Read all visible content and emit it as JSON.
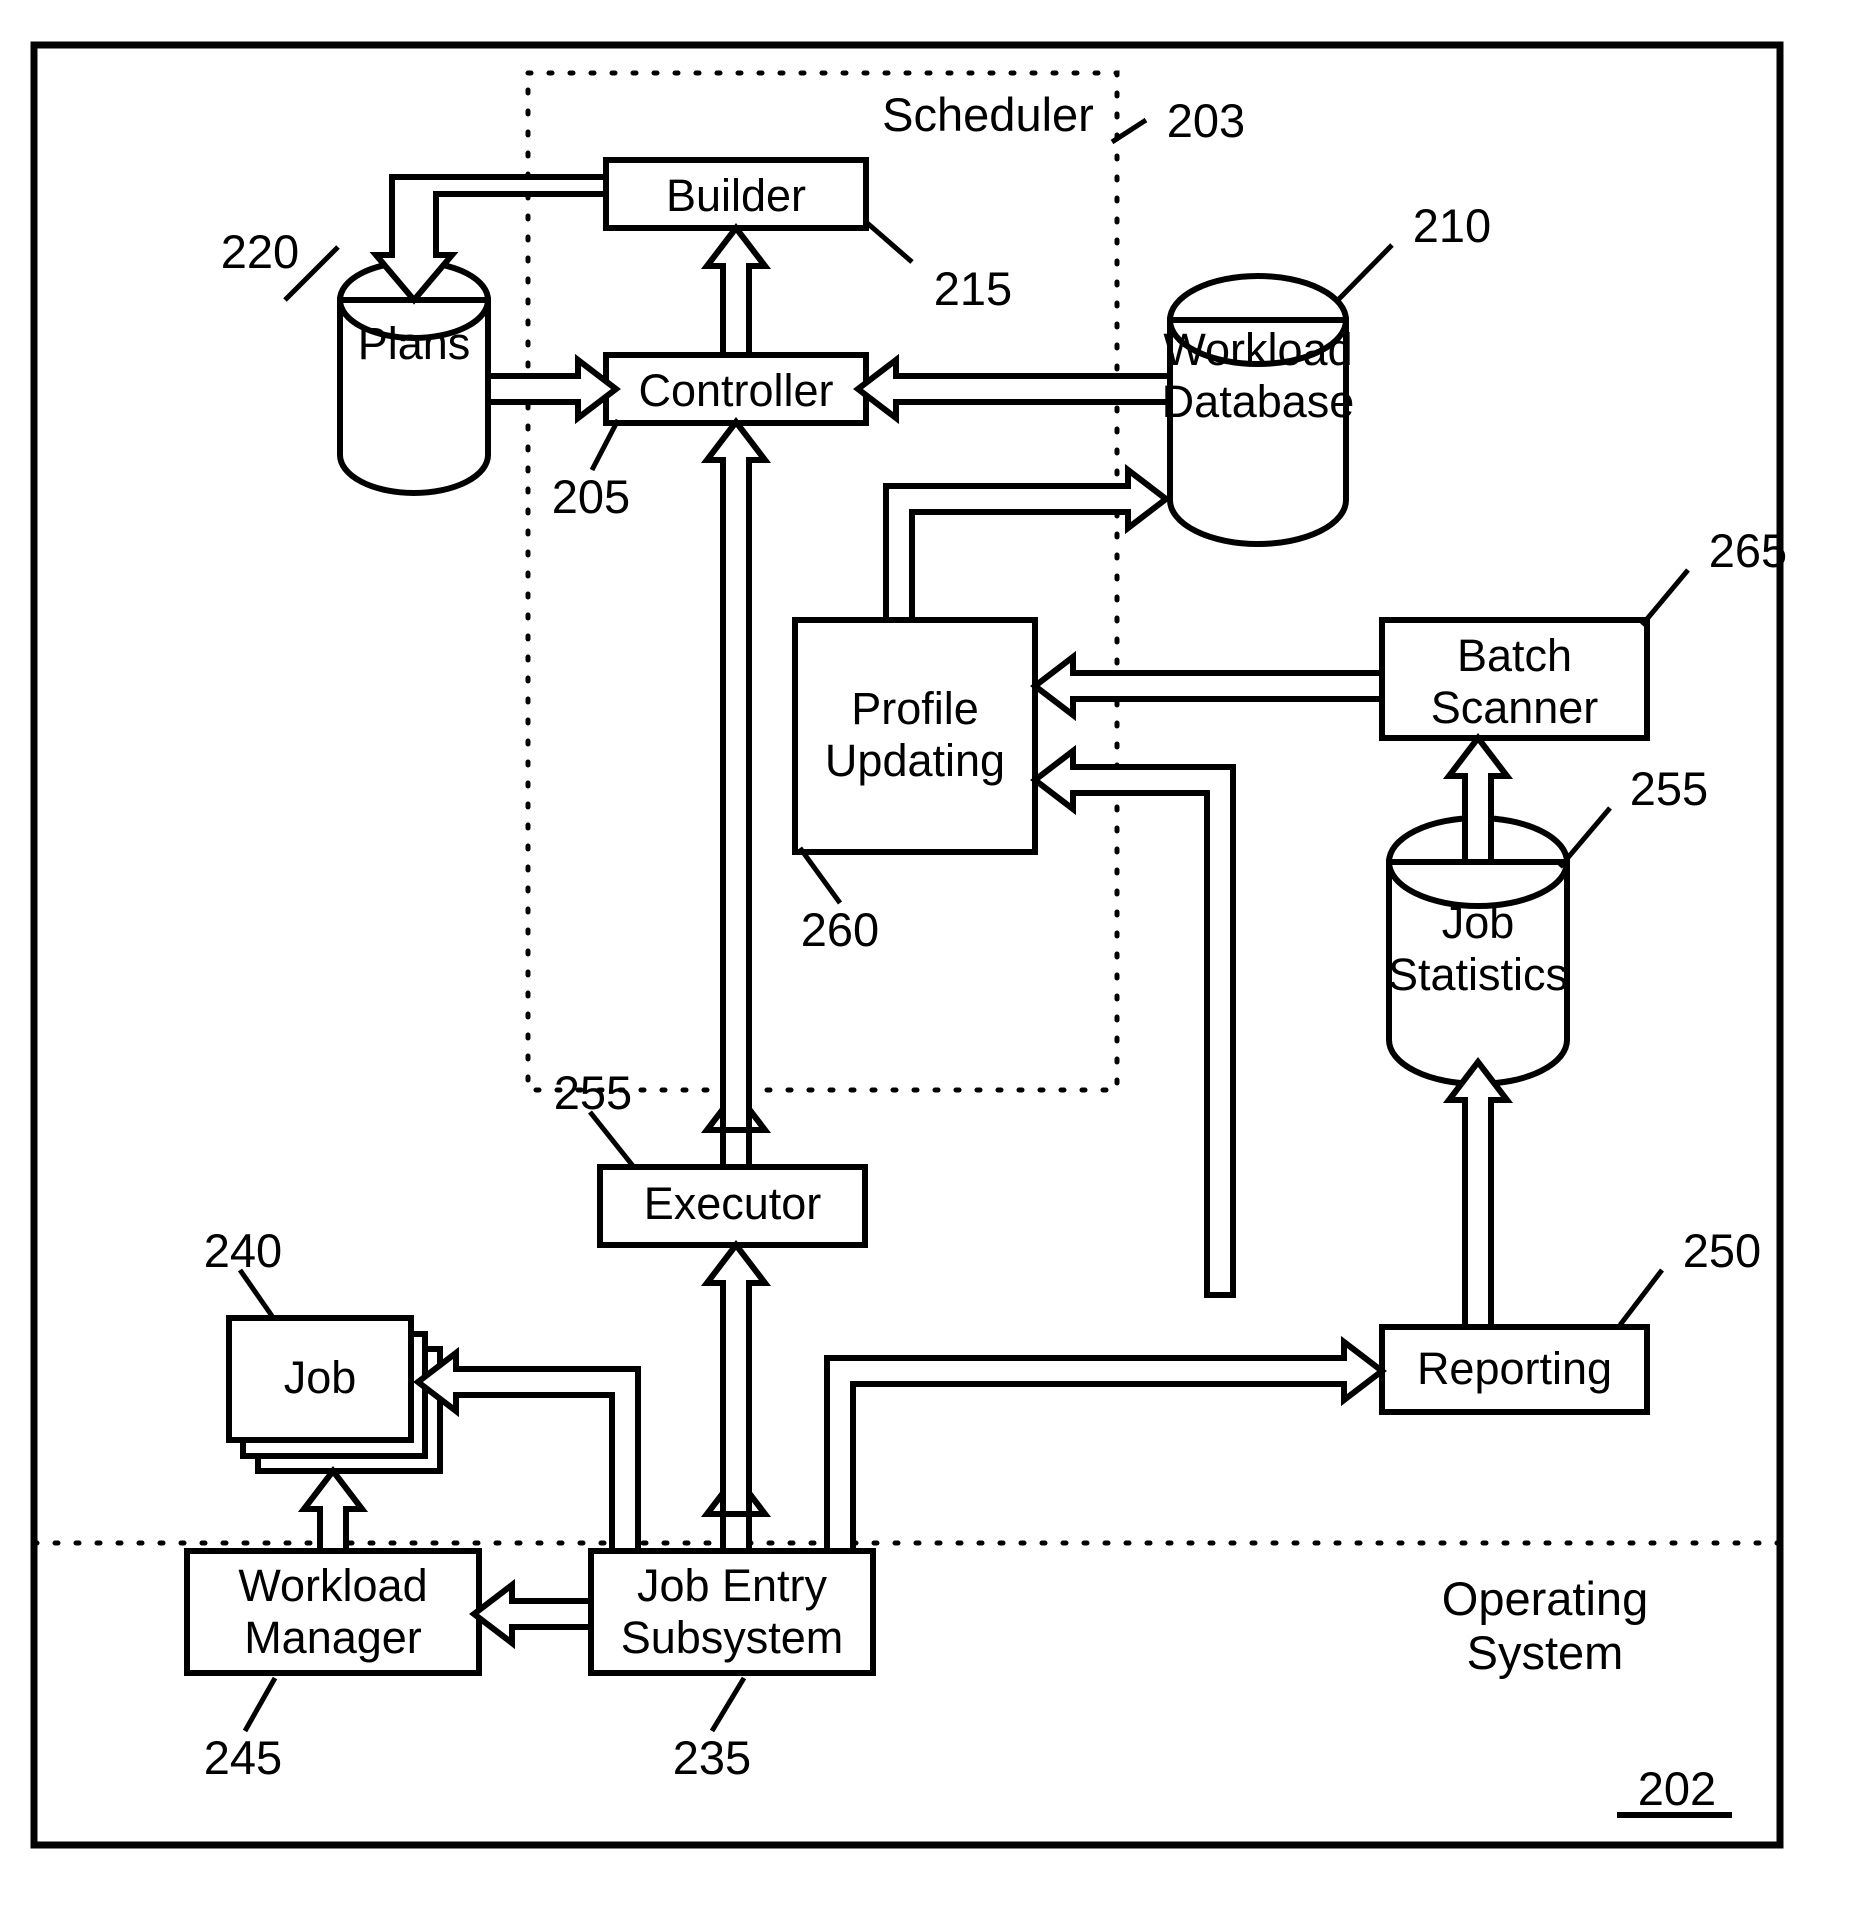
{
  "figure": {
    "type": "patent-block-diagram",
    "outer_frame_ref": "202",
    "zones": [
      {
        "id": "scheduler",
        "label": "Scheduler",
        "ref": "203",
        "boundary": "dotted"
      },
      {
        "id": "operating-system",
        "label": "Operating\nSystem",
        "ref": "202",
        "boundary": "dotted"
      }
    ],
    "nodes": [
      {
        "id": "builder",
        "label": "Builder",
        "ref": "215",
        "shape": "rect"
      },
      {
        "id": "controller",
        "label": "Controller",
        "ref": "205",
        "shape": "rect"
      },
      {
        "id": "plans",
        "label": "Plans",
        "ref": "220",
        "shape": "cylinder"
      },
      {
        "id": "workload-db",
        "label": "Workload\nDatabase",
        "ref": "210",
        "shape": "cylinder"
      },
      {
        "id": "profile-updating",
        "label": "Profile\nUpdating",
        "ref": "260",
        "shape": "rect"
      },
      {
        "id": "batch-scanner",
        "label": "Batch\nScanner",
        "ref": "265",
        "shape": "rect"
      },
      {
        "id": "job-statistics",
        "label": "Job\nStatistics",
        "ref": "255",
        "shape": "cylinder"
      },
      {
        "id": "executor",
        "label": "Executor",
        "ref": "255",
        "shape": "rect"
      },
      {
        "id": "job",
        "label": "Job",
        "ref": "240",
        "shape": "stacked-rect"
      },
      {
        "id": "reporting",
        "label": "Reporting",
        "ref": "250",
        "shape": "rect"
      },
      {
        "id": "workload-manager",
        "label": "Workload\nManager",
        "ref": "245",
        "shape": "rect"
      },
      {
        "id": "job-entry",
        "label": "Job Entry\nSubsystem",
        "ref": "235",
        "shape": "rect"
      }
    ],
    "ref_numbers": [
      "203",
      "215",
      "205",
      "220",
      "210",
      "260",
      "265",
      "255",
      "255",
      "240",
      "250",
      "245",
      "235",
      "202"
    ],
    "labels": {
      "builder": "Builder",
      "controller": "Controller",
      "plans": "Plans",
      "workload_database_l1": "Workload",
      "workload_database_l2": "Database",
      "profile_updating_l1": "Profile",
      "profile_updating_l2": "Updating",
      "batch_scanner_l1": "Batch",
      "batch_scanner_l2": "Scanner",
      "job_statistics_l1": "Job",
      "job_statistics_l2": "Statistics",
      "executor": "Executor",
      "job": "Job",
      "reporting": "Reporting",
      "workload_manager_l1": "Workload",
      "workload_manager_l2": "Manager",
      "job_entry_l1": "Job Entry",
      "job_entry_l2": "Subsystem",
      "scheduler": "Scheduler",
      "operating_l1": "Operating",
      "operating_l2": "System"
    },
    "refs": {
      "r203": "203",
      "r215": "215",
      "r205": "205",
      "r220": "220",
      "r210": "210",
      "r260": "260",
      "r265": "265",
      "r255_stats": "255",
      "r255_exec": "255",
      "r240": "240",
      "r250": "250",
      "r245": "245",
      "r235": "235",
      "r202": "202"
    },
    "colors": {
      "stroke": "#000000",
      "fill": "#ffffff",
      "background": "#ffffff"
    },
    "edges": [
      {
        "from": "builder",
        "to": "plans",
        "style": "hollow-arrow",
        "route": "left-down"
      },
      {
        "from": "controller",
        "to": "builder",
        "style": "hollow-arrow",
        "route": "up"
      },
      {
        "from": "plans",
        "to": "controller",
        "style": "hollow-arrow",
        "route": "right"
      },
      {
        "from": "workload-db",
        "to": "controller",
        "style": "hollow-arrow",
        "route": "left"
      },
      {
        "from": "profile-updating",
        "to": "workload-db",
        "style": "hollow-arrow",
        "route": "up-right"
      },
      {
        "from": "batch-scanner",
        "to": "profile-updating",
        "style": "hollow-arrow",
        "route": "left"
      },
      {
        "from": "job-statistics",
        "to": "batch-scanner",
        "style": "hollow-arrow",
        "route": "up"
      },
      {
        "from": "reporting",
        "to": "profile-updating",
        "style": "hollow-arrow",
        "route": "left"
      },
      {
        "from": "reporting",
        "to": "job-statistics",
        "style": "hollow-arrow",
        "route": "up"
      },
      {
        "from": "executor",
        "to": "controller",
        "style": "hollow-arrow-bidirectional",
        "route": "up"
      },
      {
        "from": "job-entry",
        "to": "executor",
        "style": "hollow-arrow-bidirectional",
        "route": "up"
      },
      {
        "from": "job-entry",
        "to": "job",
        "style": "hollow-arrow",
        "route": "left-up"
      },
      {
        "from": "job-entry",
        "to": "workload-manager",
        "style": "hollow-arrow",
        "route": "left"
      },
      {
        "from": "job-entry",
        "to": "reporting",
        "style": "hollow-arrow",
        "route": "right-up"
      },
      {
        "from": "workload-manager",
        "to": "job",
        "style": "hollow-arrow",
        "route": "up"
      }
    ]
  }
}
